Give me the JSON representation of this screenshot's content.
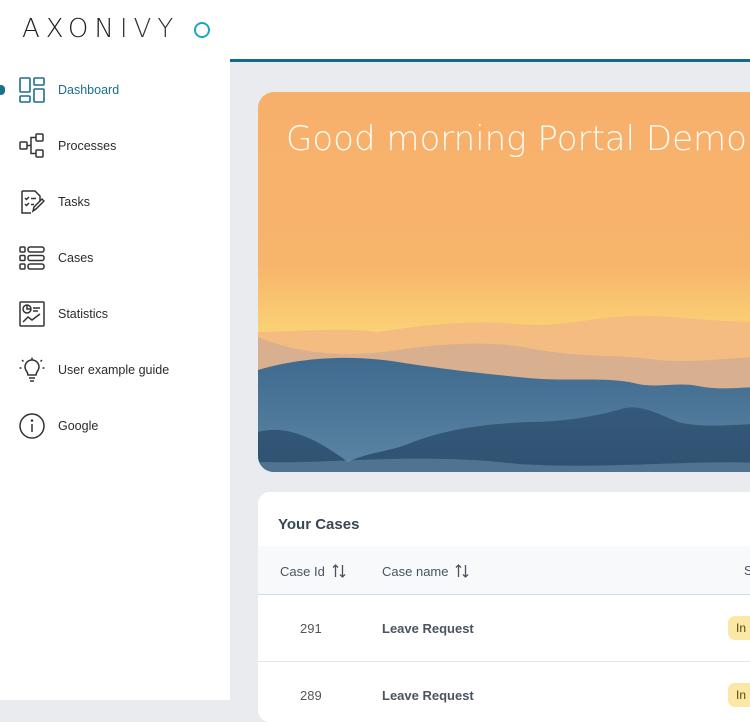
{
  "logo": {
    "text_bold": "AXON",
    "text_light": "IVY"
  },
  "sidebar": {
    "items": [
      {
        "label": "Dashboard",
        "icon": "dashboard-icon",
        "active": true
      },
      {
        "label": "Processes",
        "icon": "processes-icon"
      },
      {
        "label": "Tasks",
        "icon": "tasks-icon"
      },
      {
        "label": "Cases",
        "icon": "cases-icon"
      },
      {
        "label": "Statistics",
        "icon": "statistics-icon"
      },
      {
        "label": "User example guide",
        "icon": "lightbulb-icon"
      },
      {
        "label": "Google",
        "icon": "info-icon"
      }
    ]
  },
  "banner": {
    "greeting": "Good morning Portal Demo U"
  },
  "cases": {
    "title": "Your Cases",
    "columns": {
      "id": "Case Id",
      "name": "Case name",
      "state": "S"
    },
    "rows": [
      {
        "id": "291",
        "name": "Leave Request",
        "state": "In"
      },
      {
        "id": "289",
        "name": "Leave Request",
        "state": "In"
      }
    ]
  },
  "colors": {
    "accent": "#1b6f8a",
    "topbar_line": "#136a8a",
    "badge": "#fbe7a6"
  }
}
